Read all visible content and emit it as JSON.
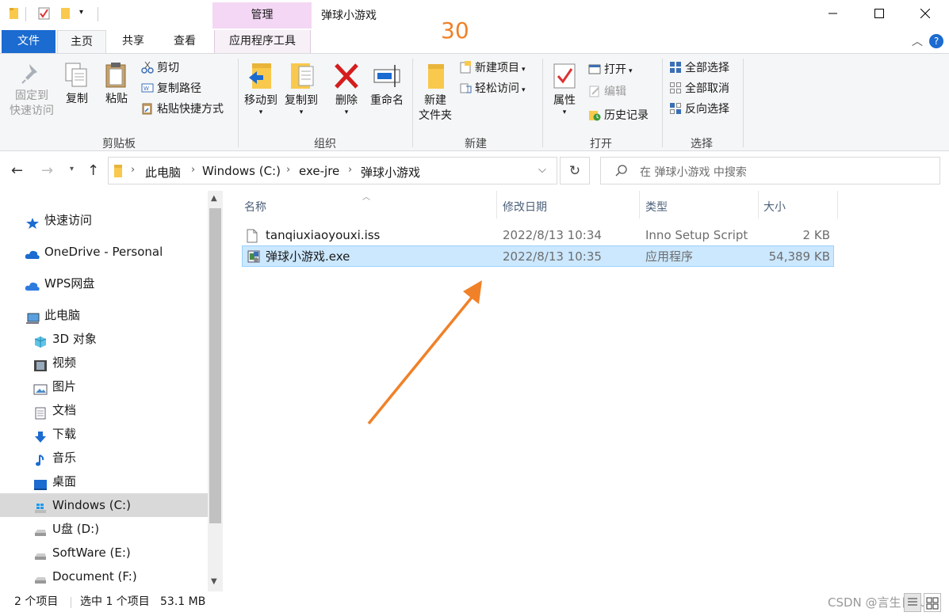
{
  "window": {
    "title": "弹球小游戏",
    "context_tab": "管理",
    "minimize": "—",
    "maximize": "☐",
    "close": "✕"
  },
  "annotation": {
    "number": "30",
    "color": "#f08128"
  },
  "ribbon_tabs": {
    "file": "文件",
    "home": "主页",
    "share": "共享",
    "view": "查看",
    "app_tools": "应用程序工具"
  },
  "ribbon": {
    "clipboard": {
      "label": "剪贴板",
      "pin_line1": "固定到",
      "pin_line2": "快速访问",
      "copy": "复制",
      "paste": "粘贴",
      "cut": "剪切",
      "copy_path": "复制路径",
      "paste_shortcut": "粘贴快捷方式"
    },
    "organize": {
      "label": "组织",
      "move_to": "移动到",
      "copy_to": "复制到",
      "delete": "删除",
      "rename": "重命名"
    },
    "new": {
      "label": "新建",
      "new_folder_line1": "新建",
      "new_folder_line2": "文件夹",
      "new_item": "新建项目",
      "easy_access": "轻松访问"
    },
    "open": {
      "label": "打开",
      "properties": "属性",
      "open": "打开",
      "edit": "编辑",
      "history": "历史记录"
    },
    "select": {
      "label": "选择",
      "select_all": "全部选择",
      "select_none": "全部取消",
      "invert": "反向选择"
    }
  },
  "address": {
    "crumbs": [
      "此电脑",
      "Windows (C:)",
      "exe-jre",
      "弹球小游戏"
    ],
    "search_placeholder": "在 弹球小游戏 中搜索"
  },
  "nav": {
    "quick_access": "快速访问",
    "onedrive": "OneDrive - Personal",
    "wps": "WPS网盘",
    "this_pc": "此电脑",
    "items": [
      "3D 对象",
      "视频",
      "图片",
      "文档",
      "下载",
      "音乐",
      "桌面",
      "Windows (C:)",
      "U盘 (D:)",
      "SoftWare (E:)",
      "Document (F:)"
    ]
  },
  "columns": {
    "name": "名称",
    "modified": "修改日期",
    "type": "类型",
    "size": "大小"
  },
  "files": [
    {
      "name": "tanqiuxiaoyouxi.iss",
      "modified": "2022/8/13 10:34",
      "type": "Inno Setup Script",
      "size": "2 KB"
    },
    {
      "name": "弹球小游戏.exe",
      "modified": "2022/8/13 10:35",
      "type": "应用程序",
      "size": "54,389 KB"
    }
  ],
  "status": {
    "count": "2 个项目",
    "selected": "选中 1 个项目",
    "selected_size": "53.1 MB"
  },
  "watermark": "CSDN @言生日LU3"
}
